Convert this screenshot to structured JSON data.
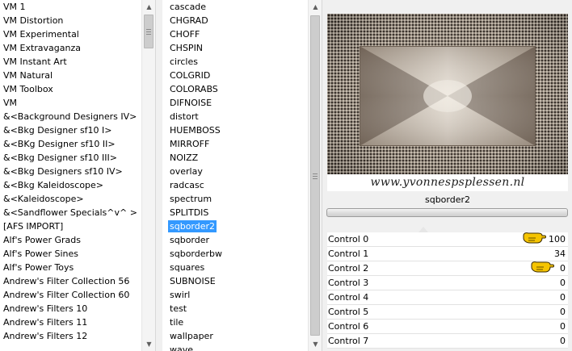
{
  "categories": {
    "items": [
      "VM 1",
      "VM Distortion",
      "VM Experimental",
      "VM Extravaganza",
      "VM Instant Art",
      "VM Natural",
      "VM Toolbox",
      "VM",
      "&<Background Designers IV>",
      "&<Bkg Designer sf10 I>",
      "&<BKg Designer sf10 II>",
      "&<Bkg Designer sf10 III>",
      "&<Bkg Designers sf10 IV>",
      "&<Bkg Kaleidoscope>",
      "&<Kaleidoscope>",
      "&<Sandflower Specials^v^ >",
      "[AFS IMPORT]",
      "Alf's Power Grads",
      "Alf's Power Sines",
      "Alf's Power Toys",
      "Andrew's Filter Collection 56",
      "Andrew's Filter Collection 60",
      "Andrew's Filters 10",
      "Andrew's Filters 11",
      "Andrew's Filters 12"
    ]
  },
  "filters": {
    "selected_index": 16,
    "items": [
      "cascade",
      "CHGRAD",
      "CHOFF",
      "CHSPIN",
      "circles",
      "COLGRID",
      "COLORABS",
      "DIFNOISE",
      "distort",
      "HUEMBOSS",
      "MIRROFF",
      "NOIZZ",
      "overlay",
      "radcasc",
      "spectrum",
      "SPLITDIS",
      "sqborder2",
      "sqborder",
      "sqborderbw",
      "squares",
      "SUBNOISE",
      "swirl",
      "test",
      "tile",
      "wallpaper",
      "wave"
    ]
  },
  "scroll": {
    "up_glyph": "▲",
    "down_glyph": "▼"
  },
  "preview": {
    "watermark": "www.yvonnespsplessen.nl",
    "filter_name": "sqborder2"
  },
  "controls": [
    {
      "label": "Control 0",
      "value": "100"
    },
    {
      "label": "Control 1",
      "value": "34"
    },
    {
      "label": "Control 2",
      "value": "0"
    },
    {
      "label": "Control 3",
      "value": "0"
    },
    {
      "label": "Control 4",
      "value": "0"
    },
    {
      "label": "Control 5",
      "value": "0"
    },
    {
      "label": "Control 6",
      "value": "0"
    },
    {
      "label": "Control 7",
      "value": "0"
    }
  ],
  "highlighted_controls": [
    0,
    2
  ],
  "colors": {
    "selection": "#3399ff",
    "pointer_hand": "#f5c400",
    "preview_dark": "#2e2721",
    "preview_light": "#d2c8ba"
  }
}
